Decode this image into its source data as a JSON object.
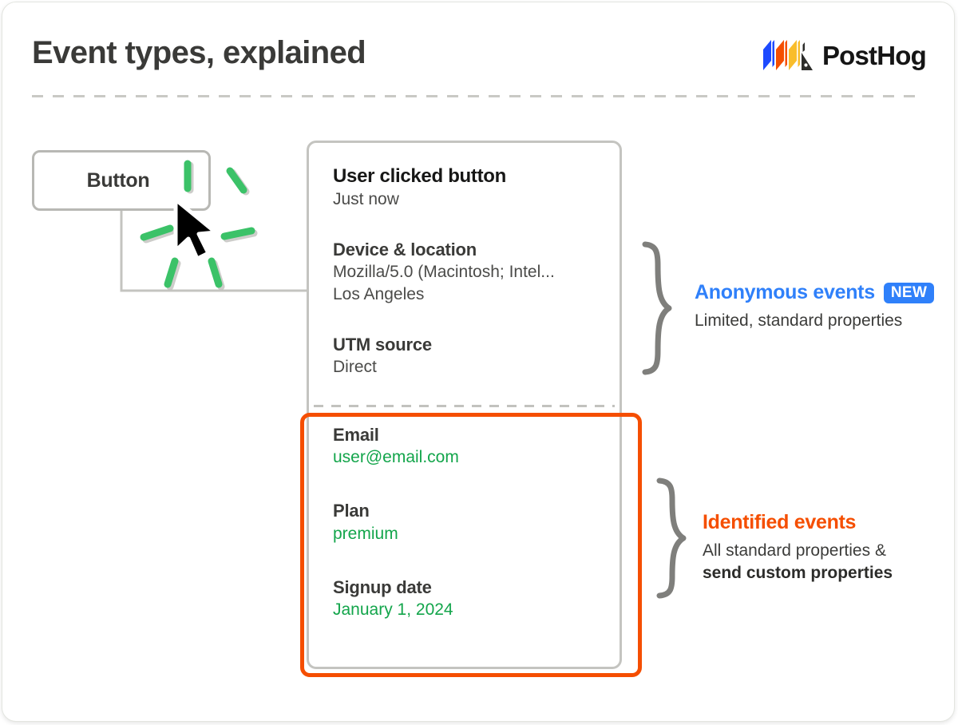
{
  "header": {
    "title": "Event types, explained",
    "brand": "PostHog",
    "logo_icon": "posthog-logo-icon",
    "accent_blue": "#2f80fa",
    "accent_orange": "#f54e00",
    "accent_green": "#13a54b",
    "logo_colors": [
      "#1d4aff",
      "#f54e00",
      "#f9bd2b",
      "#2c2c2a"
    ]
  },
  "illustration": {
    "button_label": "Button",
    "cursor_icon": "mouse-pointer-icon",
    "click_burst_icon": "click-burst-icon",
    "burst_color": "#3bc268",
    "connector_icon": "connector-line-icon"
  },
  "event_card": {
    "event_title": "User clicked button",
    "event_time": "Just now",
    "anonymous_properties": [
      {
        "key": "Device & location",
        "values": [
          "Mozilla/5.0 (Macintosh; Intel...",
          "Los Angeles"
        ]
      },
      {
        "key": "UTM source",
        "values": [
          "Direct"
        ]
      }
    ],
    "identified_properties": [
      {
        "key": "Email",
        "values": [
          "user@email.com"
        ]
      },
      {
        "key": "Plan",
        "values": [
          "premium"
        ]
      },
      {
        "key": "Signup date",
        "values": [
          "January 1, 2024"
        ]
      }
    ]
  },
  "annotations": [
    {
      "title": "Anonymous events",
      "badge": "NEW",
      "subtitle_plain": "Limited, standard properties",
      "subtitle_bold": "",
      "brace_icon": "curly-brace-icon"
    },
    {
      "title": "Identified events",
      "badge": "",
      "subtitle_plain": "All standard properties &",
      "subtitle_bold": "send custom properties",
      "brace_icon": "curly-brace-icon"
    }
  ]
}
